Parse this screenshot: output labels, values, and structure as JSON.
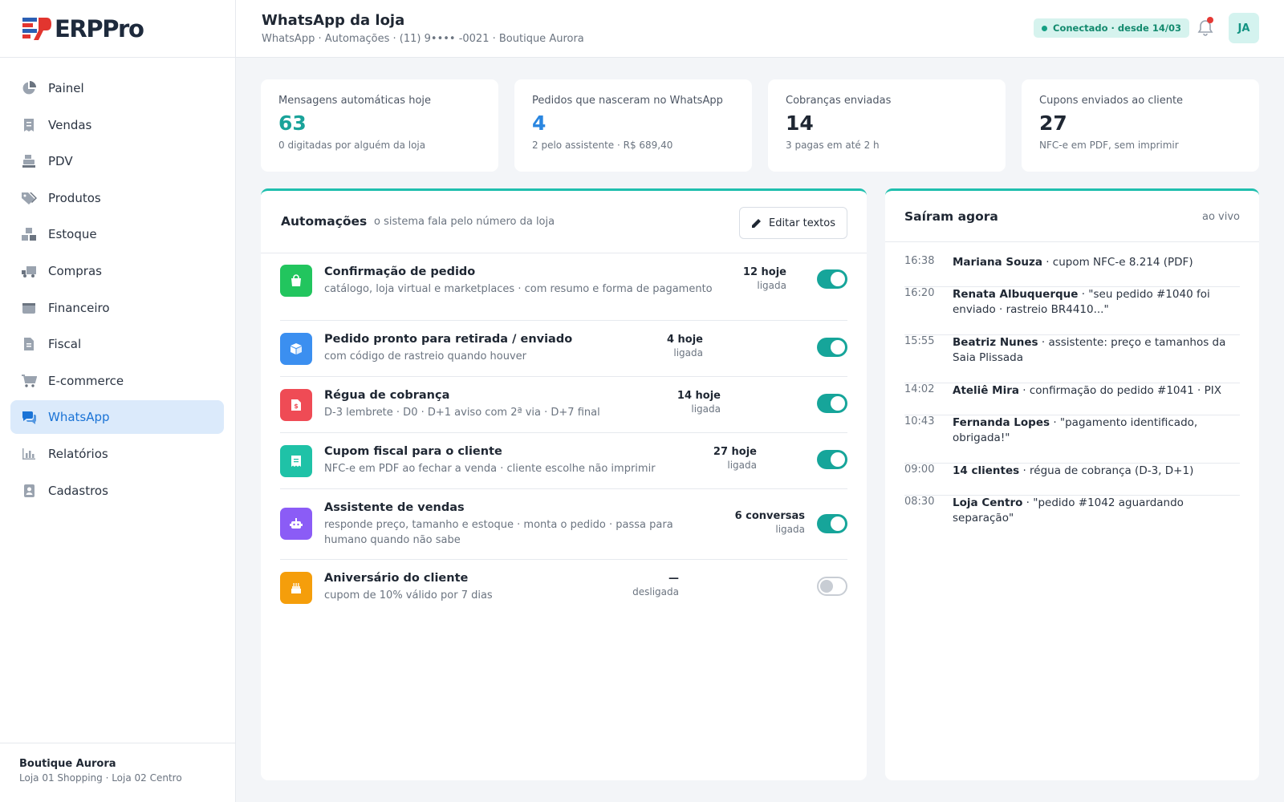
{
  "app": {
    "logo": "ERPPro"
  },
  "sidebar": {
    "items": [
      {
        "label": "Painel",
        "icon": "pie-chart-icon"
      },
      {
        "label": "Vendas",
        "icon": "receipt-icon"
      },
      {
        "label": "PDV",
        "icon": "cash-register-icon"
      },
      {
        "label": "Produtos",
        "icon": "tags-icon"
      },
      {
        "label": "Estoque",
        "icon": "boxes-icon"
      },
      {
        "label": "Compras",
        "icon": "truck-icon"
      },
      {
        "label": "Financeiro",
        "icon": "wallet-icon"
      },
      {
        "label": "Fiscal",
        "icon": "document-icon"
      },
      {
        "label": "E-commerce",
        "icon": "cart-icon"
      },
      {
        "label": "WhatsApp",
        "icon": "chat-icon",
        "active": true
      },
      {
        "label": "Relatórios",
        "icon": "bar-chart-icon"
      },
      {
        "label": "Cadastros",
        "icon": "contact-book-icon"
      }
    ],
    "store": {
      "name": "Boutique Aurora",
      "locations": "Loja 01 Shopping · Loja 02 Centro"
    }
  },
  "header": {
    "title": "WhatsApp da loja",
    "subtitle": "WhatsApp · Automações · (11) 9•••• -0021 · Boutique Aurora",
    "status": "Conectado · desde 14/03",
    "avatar": "JA"
  },
  "stats": [
    {
      "label": "Mensagens automáticas hoje",
      "value": "63",
      "note": "0 digitadas por alguém da loja",
      "color": "#1aa39a"
    },
    {
      "label": "Pedidos que nasceram no WhatsApp",
      "value": "4",
      "note": "2 pelo assistente · R$ 689,40",
      "color": "#2a86e0"
    },
    {
      "label": "Cobranças enviadas",
      "value": "14",
      "note": "3 pagas em até 2 h",
      "color": "#1f2733"
    },
    {
      "label": "Cupons enviados ao cliente",
      "value": "27",
      "note": "NFC-e em PDF, sem imprimir",
      "color": "#1f2733"
    }
  ],
  "automations": {
    "title": "Automações",
    "subtitle": "o sistema fala pelo número da loja",
    "edit_label": "Editar textos",
    "rows": [
      {
        "title": "Confirmação de pedido",
        "desc": "catálogo, loja virtual e marketplaces · com resumo e forma de pagamento",
        "count": "12 hoje",
        "state": "ligada",
        "on": true,
        "icon": "shopping-bag-icon",
        "color": "#22c55e"
      },
      {
        "title": "Pedido pronto para retirada / enviado",
        "desc": "com código de rastreio quando houver",
        "count": "4 hoje",
        "state": "ligada",
        "on": true,
        "icon": "package-icon",
        "color": "#3b8ff0"
      },
      {
        "title": "Régua de cobrança",
        "desc": "D-3 lembrete · D0 · D+1 aviso com 2ª via · D+7 final",
        "count": "14 hoje",
        "state": "ligada",
        "on": true,
        "icon": "invoice-icon",
        "color": "#ef4b55"
      },
      {
        "title": "Cupom fiscal para o cliente",
        "desc": "NFC-e em PDF ao fechar a venda · cliente escolhe não imprimir",
        "count": "27 hoje",
        "state": "ligada",
        "on": true,
        "icon": "receipt-icon",
        "color": "#1fc2a7"
      },
      {
        "title": "Assistente de vendas",
        "desc": "responde preço, tamanho e estoque · monta o pedido · passa para humano quando não sabe",
        "count": "6 conversas",
        "state": "ligada",
        "on": true,
        "icon": "robot-icon",
        "color": "#8b5cf6"
      },
      {
        "title": "Aniversário do cliente",
        "desc": "cupom de 10% válido por 7 dias",
        "count": "—",
        "state": "desligada",
        "on": false,
        "icon": "cake-icon",
        "color": "#f59e0b"
      }
    ]
  },
  "live": {
    "title": "Saíram agora",
    "badge": "ao vivo",
    "items": [
      {
        "time": "16:38",
        "name": "Mariana Souza",
        "text": " · cupom NFC-e 8.214 (PDF)"
      },
      {
        "time": "16:20",
        "name": "Renata Albuquerque",
        "text": " · \"seu pedido #1040 foi enviado · rastreio BR4410...\""
      },
      {
        "time": "15:55",
        "name": "Beatriz Nunes",
        "text": " · assistente: preço e tamanhos da Saia Plissada"
      },
      {
        "time": "14:02",
        "name": "Ateliê Mira",
        "text": " · confirmação do pedido #1041 · PIX"
      },
      {
        "time": "10:43",
        "name": "Fernanda Lopes",
        "text": " · \"pagamento identificado, obrigada!\""
      },
      {
        "time": "09:00",
        "name": "14 clientes",
        "text": " · régua de cobrança (D-3, D+1)"
      },
      {
        "time": "08:30",
        "name": "Loja Centro",
        "text": " · \"pedido #1042 aguardando separação\""
      }
    ]
  }
}
